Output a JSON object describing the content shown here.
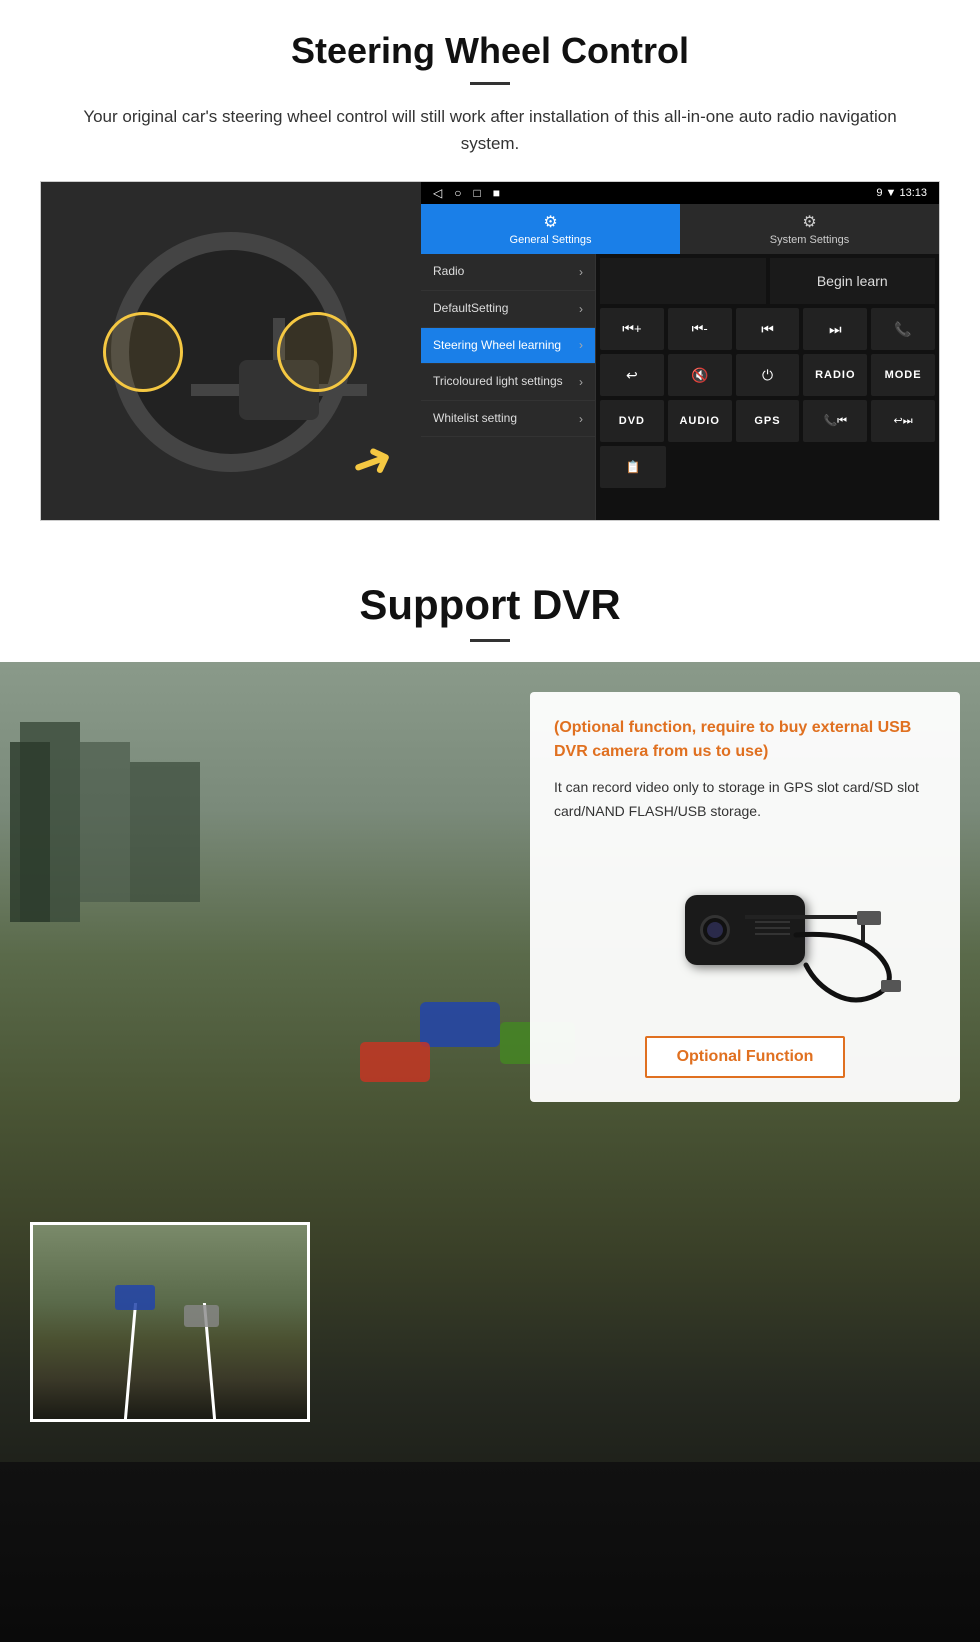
{
  "steering": {
    "title": "Steering Wheel Control",
    "subtitle": "Your original car's steering wheel control will still work after installation of this all-in-one auto radio navigation system.",
    "android_ui": {
      "statusbar": {
        "left_icons": [
          "◁",
          "○",
          "□",
          "■"
        ],
        "right_text": "9 ▼ 13:13"
      },
      "tabs": [
        {
          "label": "General Settings",
          "icon": "⚙",
          "active": true
        },
        {
          "label": "System Settings",
          "icon": "🔧",
          "active": false
        }
      ],
      "menu_items": [
        {
          "label": "Radio",
          "active": false
        },
        {
          "label": "DefaultSetting",
          "active": false
        },
        {
          "label": "Steering Wheel learning",
          "active": true
        },
        {
          "label": "Tricoloured light settings",
          "active": false
        },
        {
          "label": "Whitelist setting",
          "active": false
        }
      ],
      "begin_learn_label": "Begin learn",
      "control_buttons": {
        "row1": [
          "⏮+",
          "⏮-",
          "⏮",
          "⏭",
          "📞"
        ],
        "row2": [
          "↩",
          "🔇",
          "⏻",
          "RADIO",
          "MODE"
        ],
        "row3": [
          "DVD",
          "AUDIO",
          "GPS",
          "📞⏮",
          "↩⏭"
        ],
        "row4_icon": "📋"
      }
    }
  },
  "dvr": {
    "title": "Support DVR",
    "optional_title": "(Optional function, require to buy external USB DVR camera from us to use)",
    "description": "It can record video only to storage in GPS slot card/SD slot card/NAND FLASH/USB storage.",
    "optional_function_label": "Optional Function"
  }
}
